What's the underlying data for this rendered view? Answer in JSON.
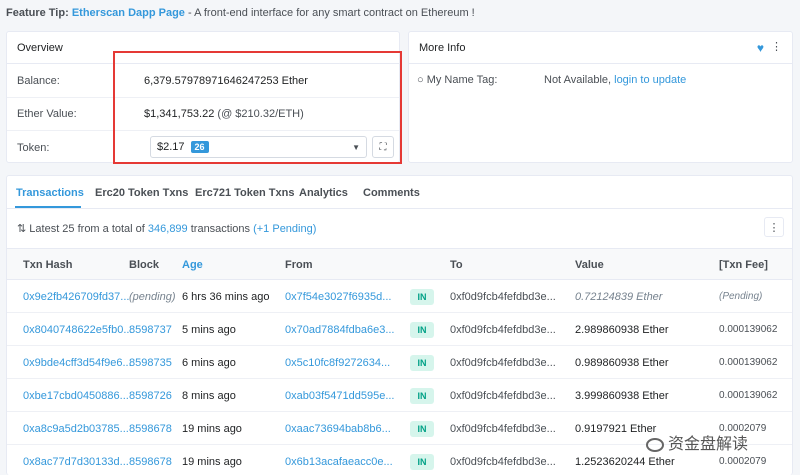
{
  "tip": {
    "prefix": "Feature Tip:",
    "link": "Etherscan Dapp Page",
    "text": " - A front-end interface for any smart contract on Ethereum !"
  },
  "overview": {
    "title": "Overview",
    "balance_label": "Balance:",
    "balance_value": "6,379.57978971646247253 Ether",
    "ether_value_label": "Ether Value:",
    "ether_value": "$1,341,753.22",
    "ether_value_rate": " (@ $210.32/ETH)",
    "token_label": "Token:",
    "token_value": "$2.17",
    "token_count": "26"
  },
  "moreinfo": {
    "title": "More Info",
    "name_tag_label": "My Name Tag:",
    "name_tag_value": "Not Available, ",
    "name_tag_link": "login to update"
  },
  "tabs": [
    "Transactions",
    "Erc20 Token Txns",
    "Erc721 Token Txns",
    "Analytics",
    "Comments"
  ],
  "summary": {
    "prefix": "Latest 25 from a total of ",
    "total": "346,899",
    "mid": " transactions ",
    "pending": "(+1 Pending)"
  },
  "table": {
    "headers": [
      "Txn Hash",
      "Block",
      "Age",
      "From",
      "To",
      "Value",
      "[Txn Fee]"
    ],
    "rows": [
      {
        "hash": "0x9e2fb426709fd37...",
        "block": "(pending)",
        "age": "6 hrs 36 mins ago",
        "from": "0x7f54e3027f6935d...",
        "dir": "IN",
        "to": "0xf0d9fcb4fefdbd3e...",
        "value": "0.72124839 Ether",
        "fee": "(Pending)"
      },
      {
        "hash": "0x8040748622e5fb0...",
        "block": "8598737",
        "age": "5 mins ago",
        "from": "0x70ad7884fdba6e3...",
        "dir": "IN",
        "to": "0xf0d9fcb4fefdbd3e...",
        "value": "2.989860938 Ether",
        "fee": "0.000139062"
      },
      {
        "hash": "0x9bde4cff3d54f9e6...",
        "block": "8598735",
        "age": "6 mins ago",
        "from": "0x5c10fc8f9272634...",
        "dir": "IN",
        "to": "0xf0d9fcb4fefdbd3e...",
        "value": "0.989860938 Ether",
        "fee": "0.000139062"
      },
      {
        "hash": "0xbe17cbd0450886...",
        "block": "8598726",
        "age": "8 mins ago",
        "from": "0xab03f5471dd595e...",
        "dir": "IN",
        "to": "0xf0d9fcb4fefdbd3e...",
        "value": "3.999860938 Ether",
        "fee": "0.000139062"
      },
      {
        "hash": "0xa8c9a5d2b03785...",
        "block": "8598678",
        "age": "19 mins ago",
        "from": "0xaac73694bab8b6...",
        "dir": "IN",
        "to": "0xf0d9fcb4fefdbd3e...",
        "value": "0.9197921 Ether",
        "fee": "0.0002079"
      },
      {
        "hash": "0x8ac77d7d30133d...",
        "block": "8598678",
        "age": "19 mins ago",
        "from": "0x6b13acafaeacc0e...",
        "dir": "IN",
        "to": "0xf0d9fcb4fefdbd3e...",
        "value": "1.2523620244 Ether",
        "fee": "0.0002079"
      }
    ]
  },
  "watermark": "资金盘解读",
  "colors": {
    "accent": "#3498db",
    "highlight": "#e53935",
    "in_badge": "#00a186"
  }
}
